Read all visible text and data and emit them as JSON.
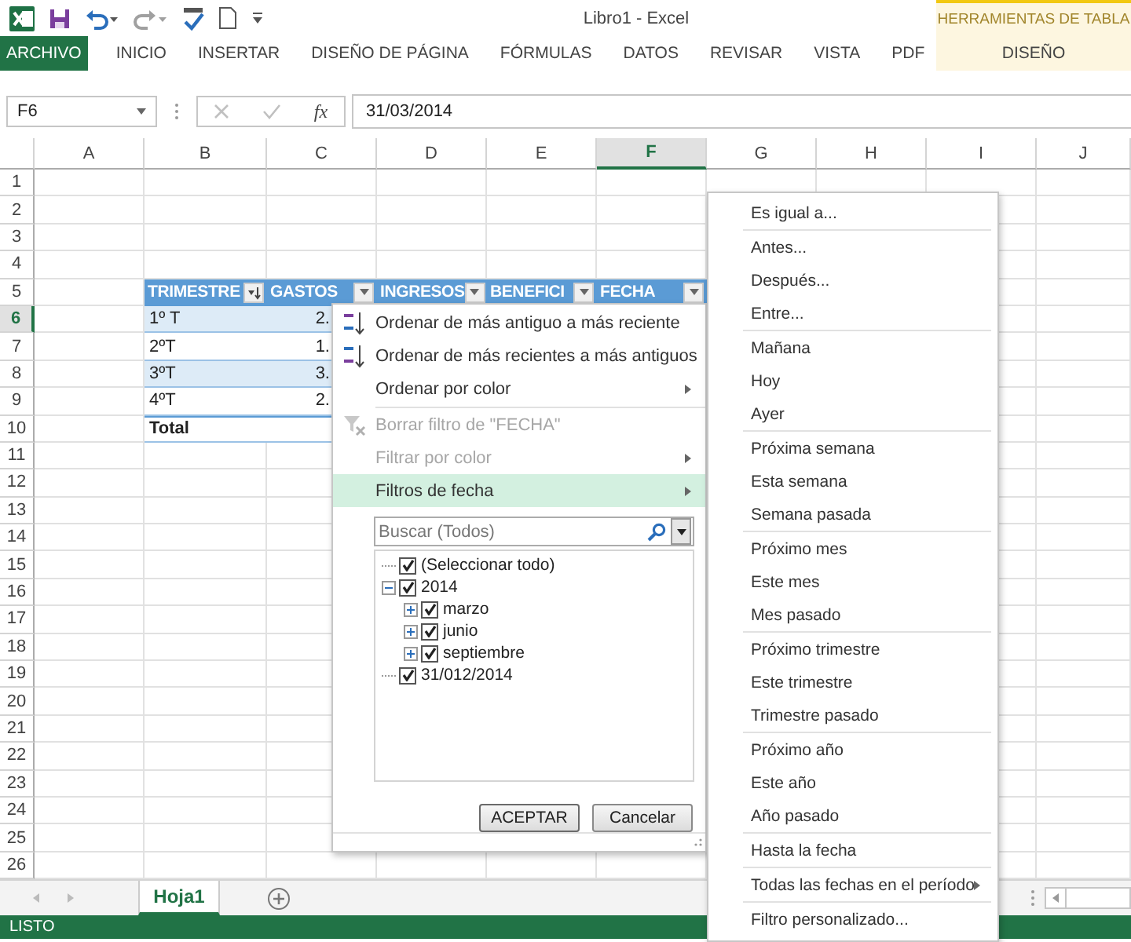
{
  "window": {
    "title": "Libro1 - Excel",
    "context_label": "HERRAMIENTAS DE TABLA"
  },
  "ribbon_tabs": [
    {
      "label": "ARCHIVO",
      "kind": "file"
    },
    {
      "label": "INICIO",
      "kind": "tab"
    },
    {
      "label": "INSERTAR",
      "kind": "tab"
    },
    {
      "label": "DISEÑO DE PÁGINA",
      "kind": "tab"
    },
    {
      "label": "FÓRMULAS",
      "kind": "tab"
    },
    {
      "label": "DATOS",
      "kind": "tab"
    },
    {
      "label": "REVISAR",
      "kind": "tab"
    },
    {
      "label": "VISTA",
      "kind": "tab"
    },
    {
      "label": "PDF",
      "kind": "tab"
    },
    {
      "label": "DISEÑO",
      "kind": "contextual"
    }
  ],
  "formula_bar": {
    "name_box": "F6",
    "function_button": "fx",
    "value": "31/03/2014"
  },
  "columns": [
    {
      "label": "A",
      "selected": false
    },
    {
      "label": "B",
      "selected": false
    },
    {
      "label": "C",
      "selected": false
    },
    {
      "label": "D",
      "selected": false
    },
    {
      "label": "E",
      "selected": false
    },
    {
      "label": "F",
      "selected": true
    },
    {
      "label": "G",
      "selected": false
    },
    {
      "label": "H",
      "selected": false
    },
    {
      "label": "I",
      "selected": false
    },
    {
      "label": "J",
      "selected": false
    }
  ],
  "rows": [
    {
      "label": "1",
      "selected": false
    },
    {
      "label": "2",
      "selected": false
    },
    {
      "label": "3",
      "selected": false
    },
    {
      "label": "4",
      "selected": false
    },
    {
      "label": "5",
      "selected": false
    },
    {
      "label": "6",
      "selected": true
    },
    {
      "label": "7",
      "selected": false
    },
    {
      "label": "8",
      "selected": false
    },
    {
      "label": "9",
      "selected": false
    },
    {
      "label": "10",
      "selected": false
    },
    {
      "label": "11",
      "selected": false
    },
    {
      "label": "12",
      "selected": false
    },
    {
      "label": "13",
      "selected": false
    },
    {
      "label": "14",
      "selected": false
    },
    {
      "label": "15",
      "selected": false
    },
    {
      "label": "16",
      "selected": false
    },
    {
      "label": "17",
      "selected": false
    },
    {
      "label": "18",
      "selected": false
    },
    {
      "label": "19",
      "selected": false
    },
    {
      "label": "20",
      "selected": false
    },
    {
      "label": "21",
      "selected": false
    },
    {
      "label": "22",
      "selected": false
    },
    {
      "label": "23",
      "selected": false
    },
    {
      "label": "24",
      "selected": false
    },
    {
      "label": "25",
      "selected": false
    },
    {
      "label": "26",
      "selected": false
    }
  ],
  "table": {
    "header": [
      {
        "label": "TRIMESTRE",
        "sorted": true
      },
      {
        "label": "GASTOS",
        "sorted": false
      },
      {
        "label": "INGRESOS",
        "sorted": false
      },
      {
        "label": "BENEFICI",
        "sorted": false
      },
      {
        "label": "FECHA",
        "sorted": false
      }
    ],
    "rows": [
      {
        "cells": [
          "1º T",
          "2."
        ]
      },
      {
        "cells": [
          "2ºT",
          "1."
        ]
      },
      {
        "cells": [
          "3ºT",
          "3."
        ]
      },
      {
        "cells": [
          "4ºT",
          "2."
        ]
      }
    ],
    "total": "Total"
  },
  "filter_menu": {
    "groups": [
      [
        {
          "label": "Ordenar de más antiguo a más reciente",
          "kind": "sort-ascending",
          "disabled": false,
          "selected": false,
          "has_submenu": false
        },
        {
          "label": "Ordenar de más recientes a más antiguos",
          "kind": "sort-descending",
          "disabled": false,
          "selected": false,
          "has_submenu": false
        },
        {
          "label": "Ordenar por color",
          "kind": "plain",
          "disabled": false,
          "selected": false,
          "has_submenu": true
        }
      ],
      [
        {
          "label": "Borrar filtro de \"FECHA\"",
          "kind": "clear-filter",
          "disabled": true,
          "selected": false,
          "has_submenu": false
        },
        {
          "label": "Filtrar por color",
          "kind": "plain",
          "disabled": true,
          "selected": false,
          "has_submenu": true
        },
        {
          "label": "Filtros de fecha",
          "kind": "plain",
          "disabled": false,
          "selected": true,
          "has_submenu": true
        }
      ]
    ],
    "search": {
      "placeholder": "Buscar (Todos)"
    },
    "tree": [
      {
        "label": "(Seleccionar todo)",
        "checked": true
      },
      {
        "label": "2014",
        "checked": true,
        "expanded": true,
        "children": [
          {
            "label": "marzo",
            "checked": true,
            "expanded": false
          },
          {
            "label": "junio",
            "checked": true,
            "expanded": false
          },
          {
            "label": "septiembre",
            "checked": true,
            "expanded": false
          }
        ]
      },
      {
        "label": "31/012/2014",
        "checked": true
      }
    ],
    "buttons": [
      {
        "label": "ACEPTAR",
        "kind": "default"
      },
      {
        "label": "Cancelar",
        "kind": "normal"
      }
    ]
  },
  "date_filter_menu": {
    "groups": [
      [
        {
          "label": "Es igual a...",
          "has_submenu": false
        }
      ],
      [
        {
          "label": "Antes...",
          "has_submenu": false
        },
        {
          "label": "Después...",
          "has_submenu": false
        },
        {
          "label": "Entre...",
          "has_submenu": false
        }
      ],
      [
        {
          "label": "Mañana",
          "has_submenu": false
        },
        {
          "label": "Hoy",
          "has_submenu": false
        },
        {
          "label": "Ayer",
          "has_submenu": false
        }
      ],
      [
        {
          "label": "Próxima semana",
          "has_submenu": false
        },
        {
          "label": "Esta semana",
          "has_submenu": false
        },
        {
          "label": "Semana pasada",
          "has_submenu": false
        }
      ],
      [
        {
          "label": "Próximo mes",
          "has_submenu": false
        },
        {
          "label": "Este mes",
          "has_submenu": false
        },
        {
          "label": "Mes pasado",
          "has_submenu": false
        }
      ],
      [
        {
          "label": "Próximo trimestre",
          "has_submenu": false
        },
        {
          "label": "Este trimestre",
          "has_submenu": false
        },
        {
          "label": "Trimestre pasado",
          "has_submenu": false
        }
      ],
      [
        {
          "label": "Próximo año",
          "has_submenu": false
        },
        {
          "label": "Este año",
          "has_submenu": false
        },
        {
          "label": "Año pasado",
          "has_submenu": false
        }
      ],
      [
        {
          "label": "Hasta la fecha",
          "has_submenu": false
        }
      ],
      [
        {
          "label": "Todas las fechas en el período",
          "has_submenu": true
        }
      ],
      [
        {
          "label": "Filtro personalizado...",
          "has_submenu": false
        }
      ]
    ]
  },
  "sheet_tabs": [
    {
      "label": "Hoja1",
      "selected": true
    }
  ],
  "status_bar": {
    "text": "LISTO"
  }
}
